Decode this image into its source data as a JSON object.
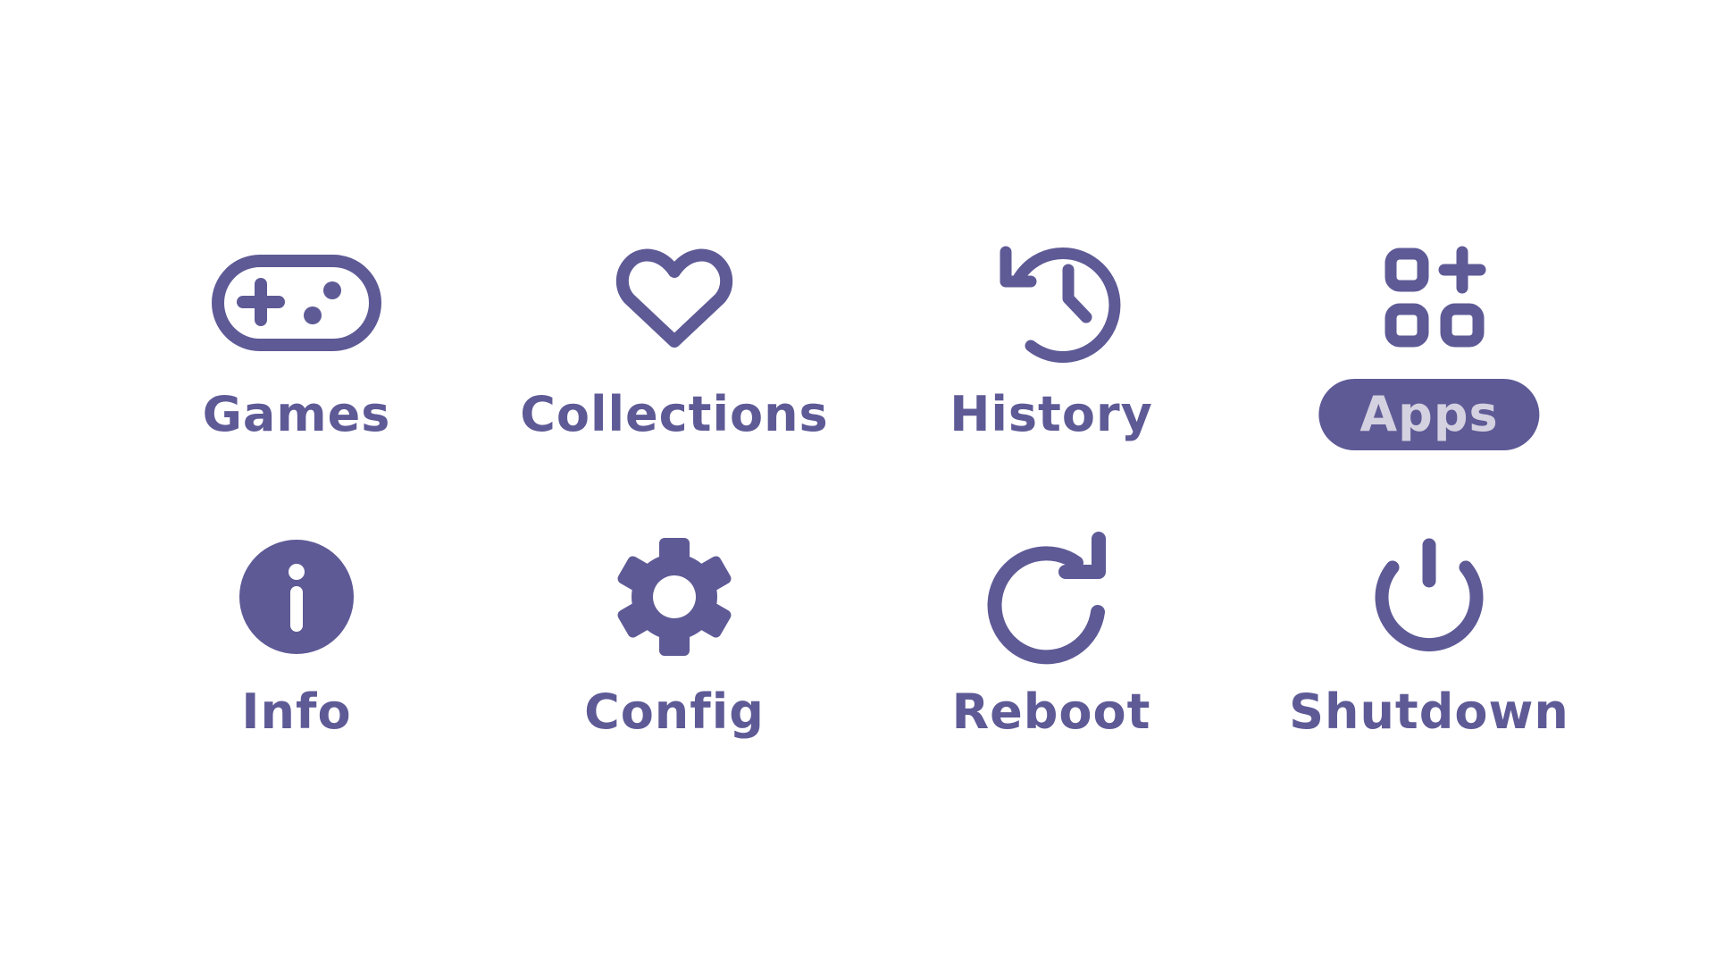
{
  "theme": {
    "accent": "#5e5a96",
    "selected_text": "#d4d1e0",
    "background": "#ffffff"
  },
  "menu": {
    "items": [
      {
        "id": "games",
        "label": "Games",
        "icon": "gamepad-icon",
        "selected": false
      },
      {
        "id": "collections",
        "label": "Collections",
        "icon": "heart-icon",
        "selected": false
      },
      {
        "id": "history",
        "label": "History",
        "icon": "history-icon",
        "selected": false
      },
      {
        "id": "apps",
        "label": "Apps",
        "icon": "apps-icon",
        "selected": true
      },
      {
        "id": "info",
        "label": "Info",
        "icon": "info-icon",
        "selected": false
      },
      {
        "id": "config",
        "label": "Config",
        "icon": "gear-icon",
        "selected": false
      },
      {
        "id": "reboot",
        "label": "Reboot",
        "icon": "reboot-icon",
        "selected": false
      },
      {
        "id": "shutdown",
        "label": "Shutdown",
        "icon": "power-icon",
        "selected": false
      }
    ]
  }
}
